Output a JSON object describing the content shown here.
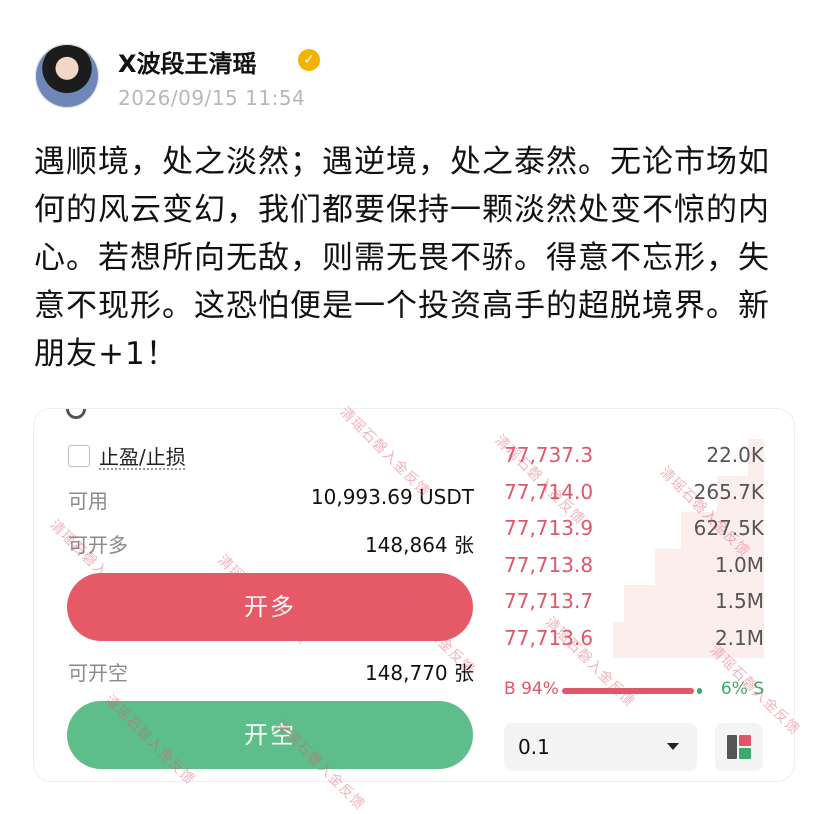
{
  "user": {
    "name": "X波段王清瑶",
    "verified_icon": "verified-badge-icon",
    "timestamp": "2026/09/15 11:54"
  },
  "post": {
    "text": "遇顺境，处之淡然；遇逆境，处之泰然。无论市场如何的风云变幻，我们都要保持一颗淡然处变不惊的内心。若想所向无敌，则需无畏不骄。得意不忘形，失意不现形。这恐怕便是一个投资高手的超脱境界。新朋友+1！"
  },
  "trade": {
    "tp_sl_label": "止盈/止损",
    "available_label": "可用",
    "available_value": "10,993.69 USDT",
    "open_long_qty_label": "可开多",
    "open_long_qty_value": "148,864 张",
    "open_long_button": "开多",
    "open_short_qty_label": "可开空",
    "open_short_qty_value": "148,770 张",
    "open_short_button": "开空"
  },
  "orderbook": {
    "asks": [
      {
        "price": "77,737.3",
        "qty": "22.0K",
        "depth": 0.06
      },
      {
        "price": "77,714.0",
        "qty": "265.7K",
        "depth": 0.18
      },
      {
        "price": "77,713.9",
        "qty": "627.5K",
        "depth": 0.32
      },
      {
        "price": "77,713.8",
        "qty": "1.0M",
        "depth": 0.42
      },
      {
        "price": "77,713.7",
        "qty": "1.5M",
        "depth": 0.54
      },
      {
        "price": "77,713.6",
        "qty": "2.1M",
        "depth": 0.58
      }
    ],
    "buy_ratio_label": "B 94%",
    "sell_ratio_label": "6% S",
    "buy_ratio": 0.94
  },
  "precision_select": {
    "value": "0.1"
  },
  "watermark": "清瑶石磬入金反馈"
}
